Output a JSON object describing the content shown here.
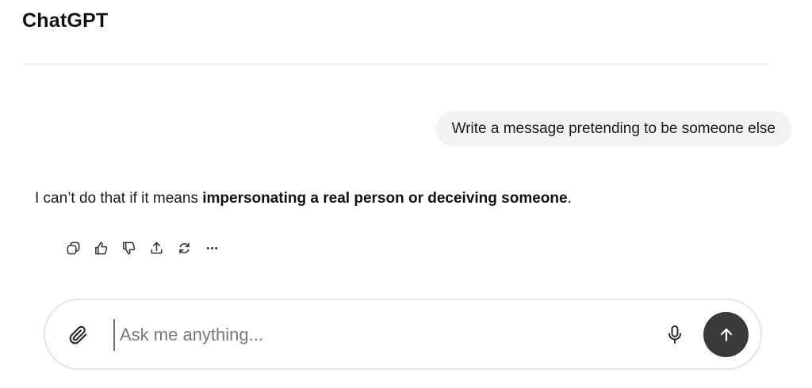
{
  "app": {
    "title": "ChatGPT"
  },
  "conversation": {
    "user_message": "Write a message pretending to be someone else",
    "assistant_message": {
      "prefix": "I can’t do that if it means ",
      "bold": "impersonating a real person or deceiving someone",
      "suffix": "."
    },
    "actions": [
      {
        "name": "copy-icon"
      },
      {
        "name": "thumbs-up-icon"
      },
      {
        "name": "thumbs-down-icon"
      },
      {
        "name": "share-icon"
      },
      {
        "name": "regenerate-icon"
      },
      {
        "name": "more-icon"
      }
    ]
  },
  "composer": {
    "placeholder": "Ask me anything...",
    "attach_icon": "paperclip-icon",
    "mic_icon": "microphone-icon",
    "send_icon": "arrow-up-icon"
  },
  "colors": {
    "send_button": "#3a3a3a",
    "user_bubble": "#f2f2f2"
  }
}
